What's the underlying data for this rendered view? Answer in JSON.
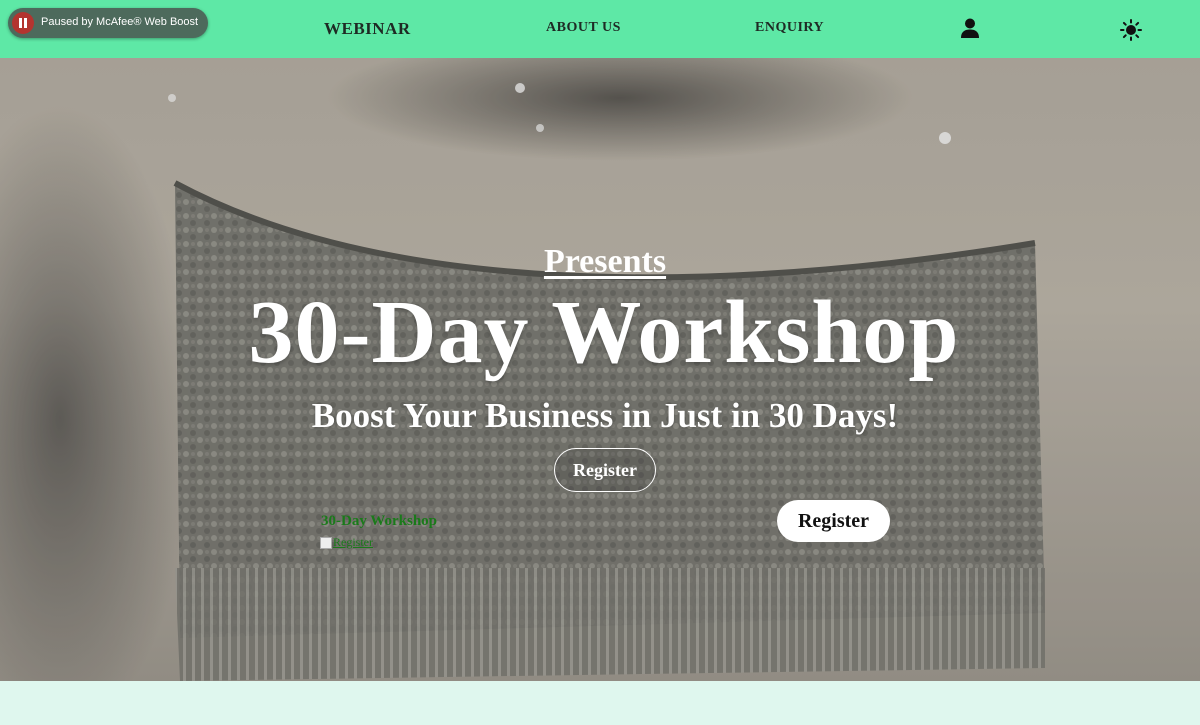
{
  "nav": {
    "items": [
      "WEBINAR",
      "ABOUT US",
      "ENQUIRY"
    ],
    "user_icon": "user-icon",
    "theme_icon": "sun-icon",
    "background": "#5ee8a6"
  },
  "extension_banner": {
    "text": "Paused by McAfee® Web Boost",
    "icon": "pause-icon"
  },
  "hero": {
    "presents": "Presents",
    "title": "30-Day Workshop",
    "subtitle": "Boost Your Business in Just in 30 Days!",
    "register_primary": "Register",
    "register_secondary": "Register",
    "broken_title": "30-Day Workshop",
    "broken_image_alt": "Register"
  },
  "colors": {
    "accent": "#5ee8a6",
    "page_bg": "#dff7ee",
    "link_green": "#1a7a1a"
  }
}
